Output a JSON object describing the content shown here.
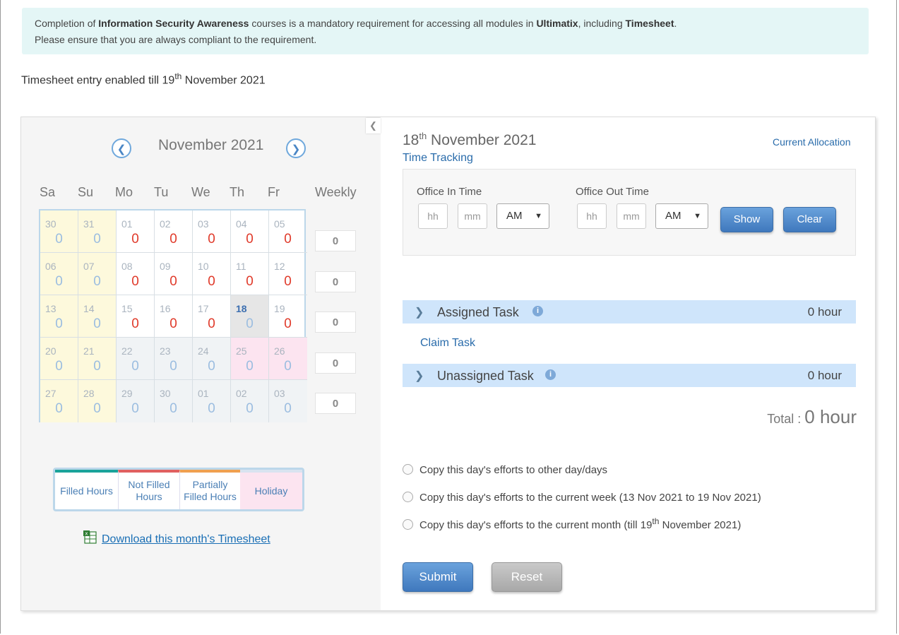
{
  "notice": {
    "p1": "Completion of ",
    "b1": "Information Security Awareness",
    "p2": " courses is a mandatory requirement for accessing all modules in ",
    "b2": "Ultimatix",
    "p3": ", including ",
    "b3": "Timesheet",
    "p4": ".",
    "line2": "Please ensure that you are always compliant to the requirement."
  },
  "enabled": {
    "pre": "Timesheet entry enabled till 19",
    "sup": "th",
    "post": " November 2021"
  },
  "calendar": {
    "prev_icon": "chevron-left-circle-icon",
    "next_icon": "chevron-right-circle-icon",
    "month_title": "November 2021",
    "days": [
      "Sa",
      "Su",
      "Mo",
      "Tu",
      "We",
      "Th",
      "Fr"
    ],
    "weekly_label": "Weekly",
    "weeks": [
      {
        "weekly": "0",
        "cells": [
          {
            "d": "30",
            "h": "0",
            "t": "weekend"
          },
          {
            "d": "31",
            "h": "0",
            "t": "weekend"
          },
          {
            "d": "01",
            "h": "0",
            "t": "red"
          },
          {
            "d": "02",
            "h": "0",
            "t": "red"
          },
          {
            "d": "03",
            "h": "0",
            "t": "red"
          },
          {
            "d": "04",
            "h": "0",
            "t": "red"
          },
          {
            "d": "05",
            "h": "0",
            "t": "red"
          }
        ]
      },
      {
        "weekly": "0",
        "cells": [
          {
            "d": "06",
            "h": "0",
            "t": "weekend"
          },
          {
            "d": "07",
            "h": "0",
            "t": "weekend"
          },
          {
            "d": "08",
            "h": "0",
            "t": "red"
          },
          {
            "d": "09",
            "h": "0",
            "t": "red"
          },
          {
            "d": "10",
            "h": "0",
            "t": "red"
          },
          {
            "d": "11",
            "h": "0",
            "t": "red"
          },
          {
            "d": "12",
            "h": "0",
            "t": "red"
          }
        ]
      },
      {
        "weekly": "0",
        "cells": [
          {
            "d": "13",
            "h": "0",
            "t": "weekend"
          },
          {
            "d": "14",
            "h": "0",
            "t": "weekend"
          },
          {
            "d": "15",
            "h": "0",
            "t": "red"
          },
          {
            "d": "16",
            "h": "0",
            "t": "red"
          },
          {
            "d": "17",
            "h": "0",
            "t": "red"
          },
          {
            "d": "18",
            "h": "0",
            "t": "today"
          },
          {
            "d": "19",
            "h": "0",
            "t": "red"
          }
        ]
      },
      {
        "weekly": "0",
        "cells": [
          {
            "d": "20",
            "h": "0",
            "t": "weekend"
          },
          {
            "d": "21",
            "h": "0",
            "t": "weekend"
          },
          {
            "d": "22",
            "h": "0",
            "t": "dim"
          },
          {
            "d": "23",
            "h": "0",
            "t": "dim"
          },
          {
            "d": "24",
            "h": "0",
            "t": "dim"
          },
          {
            "d": "25",
            "h": "0",
            "t": "holiday"
          },
          {
            "d": "26",
            "h": "0",
            "t": "holiday"
          }
        ]
      },
      {
        "weekly": "0",
        "cells": [
          {
            "d": "27",
            "h": "0",
            "t": "weekend"
          },
          {
            "d": "28",
            "h": "0",
            "t": "weekend"
          },
          {
            "d": "29",
            "h": "0",
            "t": "dim"
          },
          {
            "d": "30",
            "h": "0",
            "t": "dim"
          },
          {
            "d": "01",
            "h": "0",
            "t": "dim"
          },
          {
            "d": "02",
            "h": "0",
            "t": "dim"
          },
          {
            "d": "03",
            "h": "0",
            "t": "dim"
          }
        ]
      }
    ]
  },
  "legend": {
    "filled": "Filled Hours",
    "not_filled_1": "Not Filled",
    "not_filled_2": "Hours",
    "partial_1": "Partially",
    "partial_2": "Filled Hours",
    "holiday": "Holiday",
    "colors": {
      "filled": "#1aa39a",
      "not_filled": "#e06060",
      "partial": "#f0a050",
      "holiday": "#fce4f0"
    }
  },
  "download": {
    "icon": "excel-icon",
    "label": "Download this month's Timesheet"
  },
  "collapse_icon": "chevron-left-icon",
  "details": {
    "day": "18",
    "day_sup": "th",
    "month_year": " November 2021",
    "subtitle": "Time Tracking",
    "current_allocation": "Current Allocation",
    "in_label": "Office In Time",
    "out_label": "Office Out Time",
    "hh_placeholder": "hh",
    "mm_placeholder": "mm",
    "in_ampm": "AM",
    "out_ampm": "AM",
    "show": "Show",
    "clear": "Clear"
  },
  "tasks": {
    "assigned": {
      "label": "Assigned Task",
      "hours": "0 hour"
    },
    "claim": "Claim Task",
    "unassigned": {
      "label": "Unassigned Task",
      "hours": "0 hour"
    },
    "info_glyph": "i",
    "total_label": "Total : ",
    "total_value": "0  hour"
  },
  "copy": {
    "opt1": "Copy this day's efforts to other day/days",
    "opt2": "Copy this day's efforts to the current week (13 Nov 2021 to 19 Nov 2021)",
    "opt3_pre": "Copy this day's efforts to the current month (till 19",
    "opt3_sup": "th",
    "opt3_post": " November 2021)"
  },
  "actions": {
    "submit": "Submit",
    "reset": "Reset"
  }
}
